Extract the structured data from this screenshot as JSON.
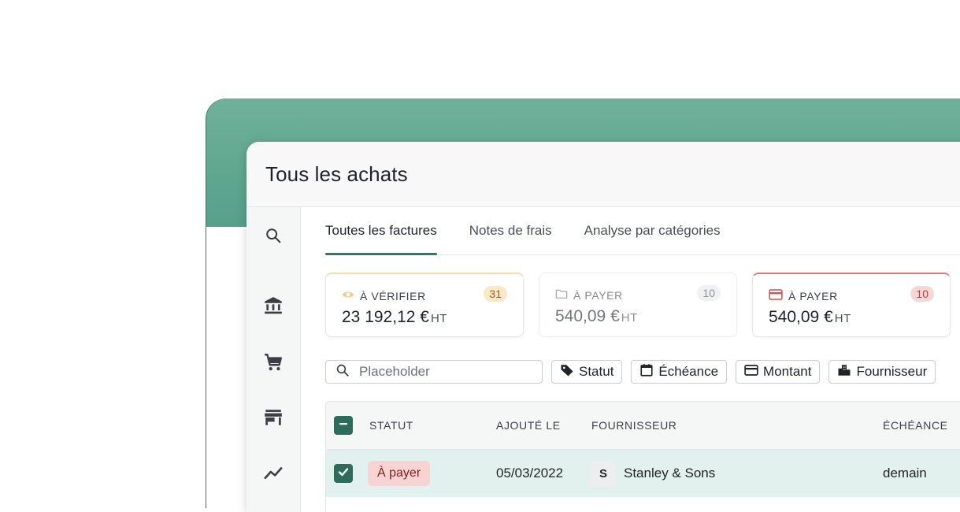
{
  "window": {
    "title": "Tous les achats"
  },
  "sidebar": {
    "icons": [
      "search-icon",
      "bank-icon",
      "cart-icon",
      "store-icon",
      "trend-chart-icon"
    ]
  },
  "tabs": [
    {
      "label": "Toutes les factures",
      "active": true
    },
    {
      "label": "Notes de frais",
      "active": false
    },
    {
      "label": "Analyse par catégories",
      "active": false
    }
  ],
  "cards": [
    {
      "icon": "eye-icon",
      "label": "À VÉRIFIER",
      "count": "31",
      "amount": "23 192,12 €",
      "unit": "HT",
      "state": "warn"
    },
    {
      "icon": "folder-icon",
      "label": "À PAYER",
      "count": "10",
      "amount": "540,09 €",
      "unit": "HT",
      "state": "muted"
    },
    {
      "icon": "credit-card-icon",
      "label": "À PAYER",
      "count": "10",
      "amount": "540,09 €",
      "unit": "HT",
      "state": "selected"
    }
  ],
  "filters": {
    "search_placeholder": "Placeholder",
    "chips": [
      {
        "icon": "tag-icon",
        "label": "Statut"
      },
      {
        "icon": "calendar-icon",
        "label": "Échéance"
      },
      {
        "icon": "card-icon",
        "label": "Montant"
      },
      {
        "icon": "building-icon",
        "label": "Fournisseur"
      }
    ]
  },
  "table": {
    "columns": {
      "status": "STATUT",
      "added": "AJOUTÉ LE",
      "supplier": "FOURNISSEUR",
      "due": "ÉCHÉANCE"
    },
    "rows": [
      {
        "selected": true,
        "status": "À payer",
        "added": "05/03/2022",
        "supplier_initial": "S",
        "supplier": "Stanley & Sons",
        "due": "demain"
      }
    ]
  },
  "colors": {
    "accent": "#2c7a66",
    "row_selected": "#e2f1ed",
    "status_pill": "#f8d3d3",
    "card_selected_border": "#e07a7a"
  }
}
